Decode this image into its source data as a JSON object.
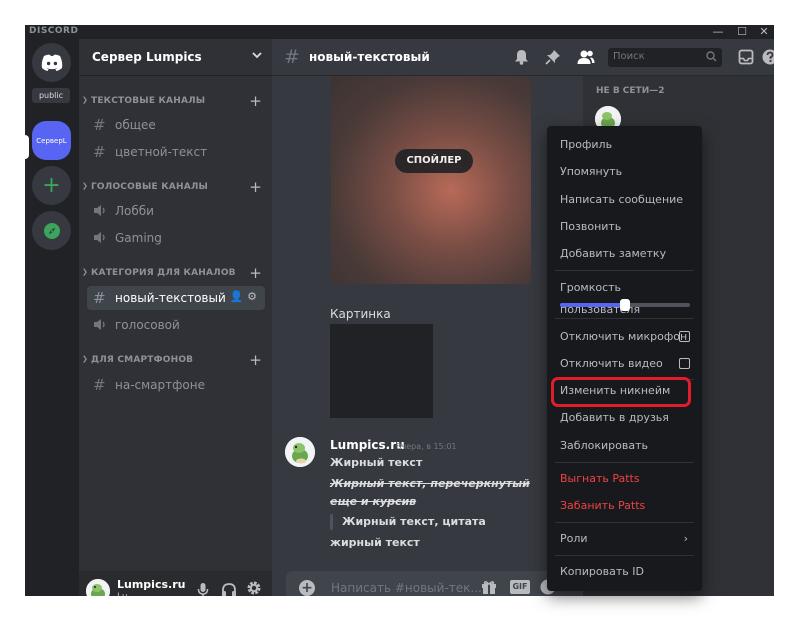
{
  "app": {
    "brand": "DISCORD"
  },
  "window_controls": {
    "minimize": "—",
    "maximize": "☐",
    "close": "✕"
  },
  "rail": {
    "home_icon": "discord-logo-icon",
    "public_label": "public",
    "server_abbrev": "СерверL",
    "add_label": "+"
  },
  "server": {
    "name": "Сервер Lumpics"
  },
  "categories": [
    {
      "label": "ТЕКСТОВЫЕ КАНАЛЫ"
    },
    {
      "label": "ГОЛОСОВЫЕ КАНАЛЫ"
    },
    {
      "label": "КАТЕГОРИЯ ДЛЯ КАНАЛОВ"
    },
    {
      "label": "ДЛЯ СМАРТФОНОВ"
    }
  ],
  "channels": [
    {
      "name": "общее",
      "type": "text"
    },
    {
      "name": "цветной-текст",
      "type": "text"
    },
    {
      "name": "Лобби",
      "type": "voice"
    },
    {
      "name": "Gaming",
      "type": "voice"
    },
    {
      "name": "новый-текстовый",
      "type": "text",
      "active": true
    },
    {
      "name": "голосовой",
      "type": "voice"
    },
    {
      "name": "на-смартфоне",
      "type": "text"
    }
  ],
  "user": {
    "name": "Lumpics.ru",
    "tag": "Lu"
  },
  "header": {
    "channel": "новый-текстовый",
    "search_placeholder": "Поиск"
  },
  "content": {
    "spoiler_label": "СПОЙЛЕР",
    "caption": "Картинка"
  },
  "message": {
    "author": "Lumpics.ru",
    "time": "Вчера, в 15:01",
    "lines": [
      "Жирный текст",
      "Жирный текст, перечеркнутый",
      "еще и курсив",
      "Жирный текст, цитата",
      "жирный текст"
    ]
  },
  "composer": {
    "placeholder": "Написать #новый-тек...",
    "gif_label": "GIF"
  },
  "members": {
    "offline_header": "НЕ В СЕТИ—2"
  },
  "context_menu": {
    "items": [
      {
        "label": "Профиль"
      },
      {
        "label": "Упомянуть"
      },
      {
        "label": "Написать сообщение"
      },
      {
        "label": "Позвонить"
      },
      {
        "label": "Добавить заметку"
      },
      {
        "label": "Громкость пользователя"
      },
      {
        "label": "Отключить микрофон"
      },
      {
        "label": "Отключить видео"
      },
      {
        "label": "Изменить никнейм"
      },
      {
        "label": "Добавить в друзья"
      },
      {
        "label": "Заблокировать"
      },
      {
        "label": "Выгнать Patts"
      },
      {
        "label": "Забанить Patts"
      },
      {
        "label": "Роли"
      },
      {
        "label": "Копировать ID"
      }
    ],
    "volume_fraction": 0.5,
    "danger_color": "#ed4245",
    "highlight_color": "#e11d2b"
  },
  "colors": {
    "accent": "#5865f2",
    "add_server": "#3ba55d"
  }
}
